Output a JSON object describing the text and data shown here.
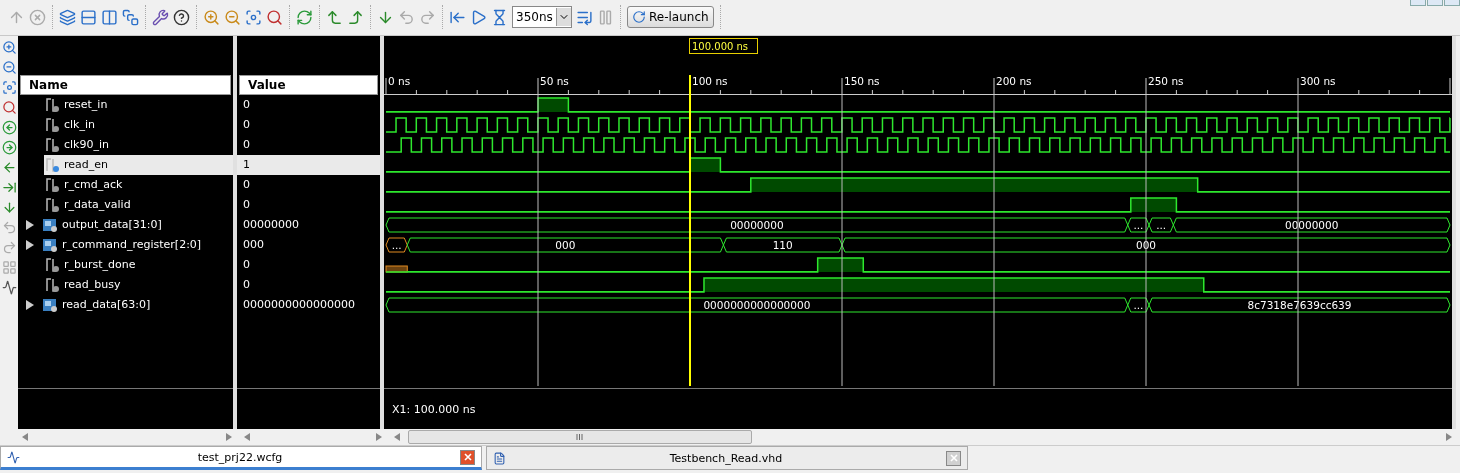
{
  "toolbar": {
    "groups": [
      [
        {
          "kind": "icon",
          "disabled": true
        },
        {
          "kind": "icon",
          "disabled": true
        }
      ],
      [
        {
          "kind": "icon",
          "disabled": false
        },
        {
          "kind": "icon",
          "disabled": false
        },
        {
          "kind": "icon",
          "disabled": false
        },
        {
          "kind": "icon",
          "disabled": false
        }
      ],
      [
        {
          "kind": "icon",
          "disabled": false
        },
        {
          "kind": "icon",
          "disabled": false
        }
      ],
      [
        {
          "kind": "icon",
          "disabled": false
        },
        {
          "kind": "icon",
          "disabled": false
        },
        {
          "kind": "icon",
          "disabled": false
        },
        {
          "kind": "icon",
          "disabled": false
        }
      ],
      [
        {
          "kind": "icon",
          "disabled": false
        }
      ],
      [
        {
          "kind": "icon",
          "disabled": false
        },
        {
          "kind": "icon",
          "disabled": false
        }
      ],
      [
        {
          "kind": "icon",
          "disabled": false
        },
        {
          "kind": "icon",
          "disabled": true
        },
        {
          "kind": "icon",
          "disabled": true
        }
      ],
      [
        {
          "kind": "icon",
          "disabled": false
        },
        {
          "kind": "icon",
          "disabled": false
        },
        {
          "kind": "icon",
          "disabled": false
        },
        {
          "kind": "combo",
          "value": "350ns"
        },
        {
          "kind": "icon",
          "disabled": false
        },
        {
          "kind": "icon",
          "disabled": true
        }
      ],
      [
        {
          "kind": "button",
          "label": "Re-launch"
        }
      ]
    ]
  },
  "side_tools": [
    {
      "disabled": false
    },
    {
      "disabled": false
    },
    {
      "disabled": false
    },
    {
      "disabled": false
    },
    {
      "disabled": false
    },
    {
      "disabled": false
    },
    {
      "disabled": false
    },
    {
      "disabled": false
    },
    {
      "disabled": false
    },
    {
      "disabled": true
    },
    {
      "disabled": true
    },
    {
      "disabled": true
    },
    {
      "disabled": false
    }
  ],
  "columns": {
    "name": "Name",
    "value": "Value"
  },
  "timeline": {
    "ticks": [
      "0 ns",
      "50 ns",
      "100 ns",
      "150 ns",
      "200 ns",
      "250 ns",
      "300 ns"
    ]
  },
  "cursor": {
    "label": "100.000 ns",
    "readout": "X1: 100.000 ns"
  },
  "signals": [
    {
      "name": "reset_in",
      "value": "0",
      "kind": "bit",
      "selected": false,
      "segments": [
        {
          "high": false
        },
        {
          "high": true
        },
        {
          "high": false
        }
      ]
    },
    {
      "name": "clk_in",
      "value": "0",
      "kind": "clock",
      "selected": false
    },
    {
      "name": "clk90_in",
      "value": "0",
      "kind": "clock",
      "selected": false
    },
    {
      "name": "read_en",
      "value": "1",
      "kind": "bit",
      "selected": true,
      "segments": [
        {
          "high": false
        },
        {
          "high": true
        },
        {
          "high": false
        }
      ]
    },
    {
      "name": "r_cmd_ack",
      "value": "0",
      "kind": "bit",
      "selected": false,
      "segments": [
        {
          "high": false
        },
        {
          "high": true
        },
        {
          "high": false
        }
      ]
    },
    {
      "name": "r_data_valid",
      "value": "0",
      "kind": "bit",
      "selected": false,
      "segments": [
        {
          "high": false
        },
        {
          "high": true
        },
        {
          "high": false
        }
      ]
    },
    {
      "name": "output_data[31:0]",
      "value": "00000000",
      "kind": "bus",
      "selected": false,
      "expanded": false,
      "segments": [
        {
          "label": "00000000",
          "undefined": false
        },
        {
          "label": "...",
          "undefined": false
        },
        {
          "label": "...",
          "undefined": false
        },
        {
          "label": "00000000",
          "undefined": false
        }
      ]
    },
    {
      "name": "r_command_register[2:0]",
      "value": "000",
      "kind": "bus",
      "selected": false,
      "expanded": false,
      "segments": [
        {
          "label": "...",
          "undefined": true
        },
        {
          "label": "000",
          "undefined": false
        },
        {
          "label": "110",
          "undefined": false
        },
        {
          "label": "000",
          "undefined": false
        }
      ]
    },
    {
      "name": "r_burst_done",
      "value": "0",
      "kind": "bit",
      "selected": false,
      "segments": [
        {
          "high": false,
          "undefined": true
        },
        {
          "high": false,
          "undefined": false
        },
        {
          "high": true,
          "undefined": false
        },
        {
          "high": false,
          "undefined": false
        }
      ]
    },
    {
      "name": "read_busy",
      "value": "0",
      "kind": "bit",
      "selected": false,
      "segments": [
        {
          "high": false
        },
        {
          "high": true
        },
        {
          "high": false
        }
      ]
    },
    {
      "name": "read_data[63:0]",
      "value": "0000000000000000",
      "kind": "bus",
      "selected": false,
      "expanded": false,
      "segments": [
        {
          "label": "0000000000000000",
          "undefined": false
        },
        {
          "label": "...",
          "undefined": false
        },
        {
          "label": "8c7318e7639cc639",
          "undefined": false
        }
      ]
    }
  ],
  "tabs": [
    {
      "label": "test_prj22.wcfg",
      "selected": true
    },
    {
      "label": "Testbench_Read.vhd",
      "selected": false
    }
  ]
}
